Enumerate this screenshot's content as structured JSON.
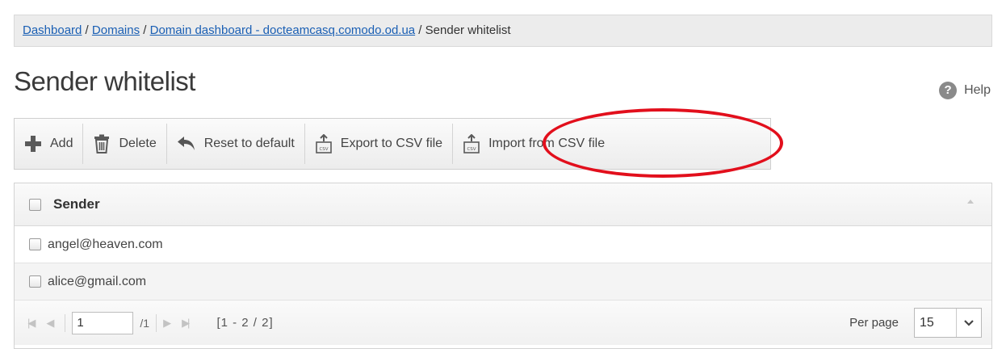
{
  "breadcrumb": {
    "links": [
      "Dashboard",
      "Domains",
      "Domain dashboard - docteamcasq.comodo.od.ua"
    ],
    "separator": " / ",
    "current": "Sender whitelist"
  },
  "page": {
    "title": "Sender whitelist",
    "help_label": "Help",
    "help_icon": "question-circle-icon"
  },
  "toolbar": {
    "add_label": "Add",
    "delete_label": "Delete",
    "reset_label": "Reset to default",
    "export_label": "Export to CSV file",
    "import_label": "Import from CSV file"
  },
  "grid": {
    "column_header": "Sender",
    "rows": [
      {
        "sender": "angel@heaven.com"
      },
      {
        "sender": "alice@gmail.com"
      }
    ]
  },
  "pager": {
    "current_page": "1",
    "total_pages": "/1",
    "range": "[1 - 2 / 2]",
    "per_page_label": "Per page",
    "per_page_value": "15"
  },
  "colors": {
    "highlight": "#e20f1c",
    "link": "#1a5fb4"
  }
}
